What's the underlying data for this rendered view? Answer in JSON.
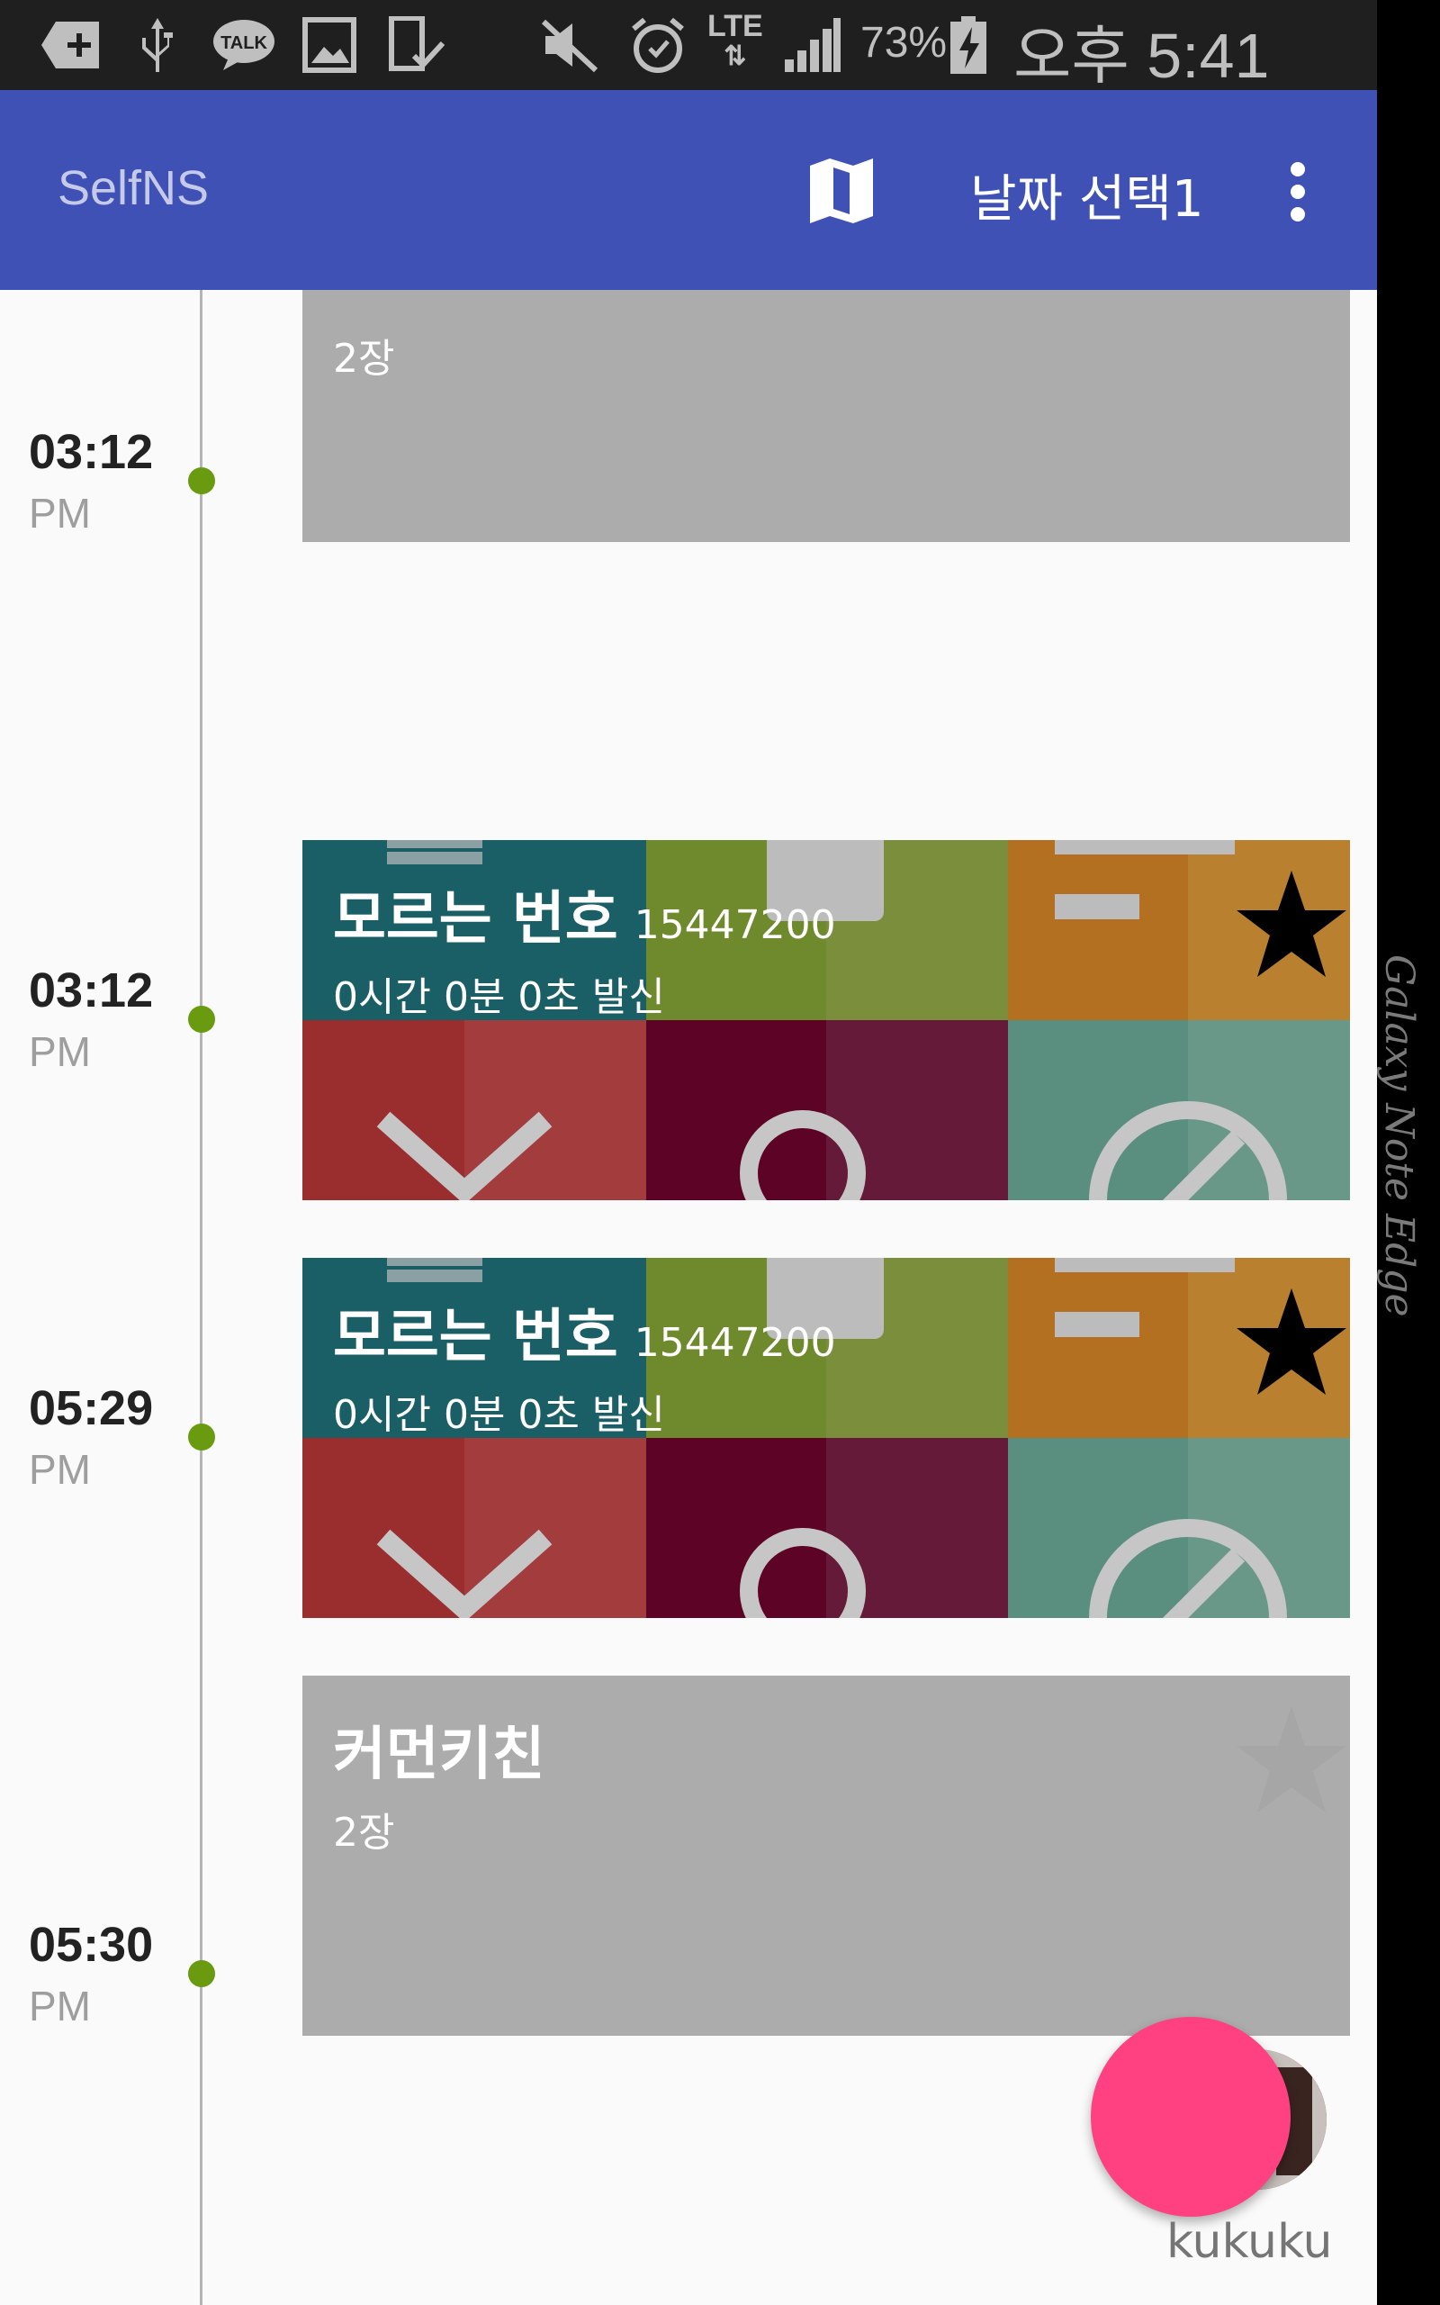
{
  "status_bar": {
    "battery": "73%",
    "network": "LTE",
    "time": "오후 5:41",
    "icons": [
      "add-icon",
      "usb-icon",
      "talk-icon",
      "gallery-icon",
      "device-check-icon",
      "mute-icon",
      "alarm-icon",
      "lte-data-icon",
      "signal-icon",
      "battery-charging-icon"
    ],
    "talk_label": "TALK"
  },
  "app_bar": {
    "title": "SelfNS",
    "date_select_label": "날짜 선택1",
    "color": "#3f51b5"
  },
  "timeline": {
    "entries": [
      {
        "time": "03:12",
        "ampm": "PM"
      },
      {
        "time": "03:12",
        "ampm": "PM"
      },
      {
        "time": "05:29",
        "ampm": "PM"
      },
      {
        "time": "05:30",
        "ampm": "PM"
      }
    ],
    "dot_color": "#6a9a10"
  },
  "cards": [
    {
      "type": "photo",
      "subtitle": "2장"
    },
    {
      "type": "call",
      "title": "모르는 번호",
      "number": "15447200",
      "subtitle": "0시간 0분 0초 발신",
      "starred": true
    },
    {
      "type": "call",
      "title": "모르는 번호",
      "number": "15447200",
      "subtitle": "0시간 0분 0초 발신",
      "starred": true
    },
    {
      "type": "photo",
      "title": "커먼키친",
      "subtitle": "2장",
      "starred": false
    }
  ],
  "fab": {
    "color": "#ff4081"
  },
  "profile": {
    "name": "kukuku"
  },
  "edge_panel": {
    "text": "Galaxy Note Edge"
  }
}
